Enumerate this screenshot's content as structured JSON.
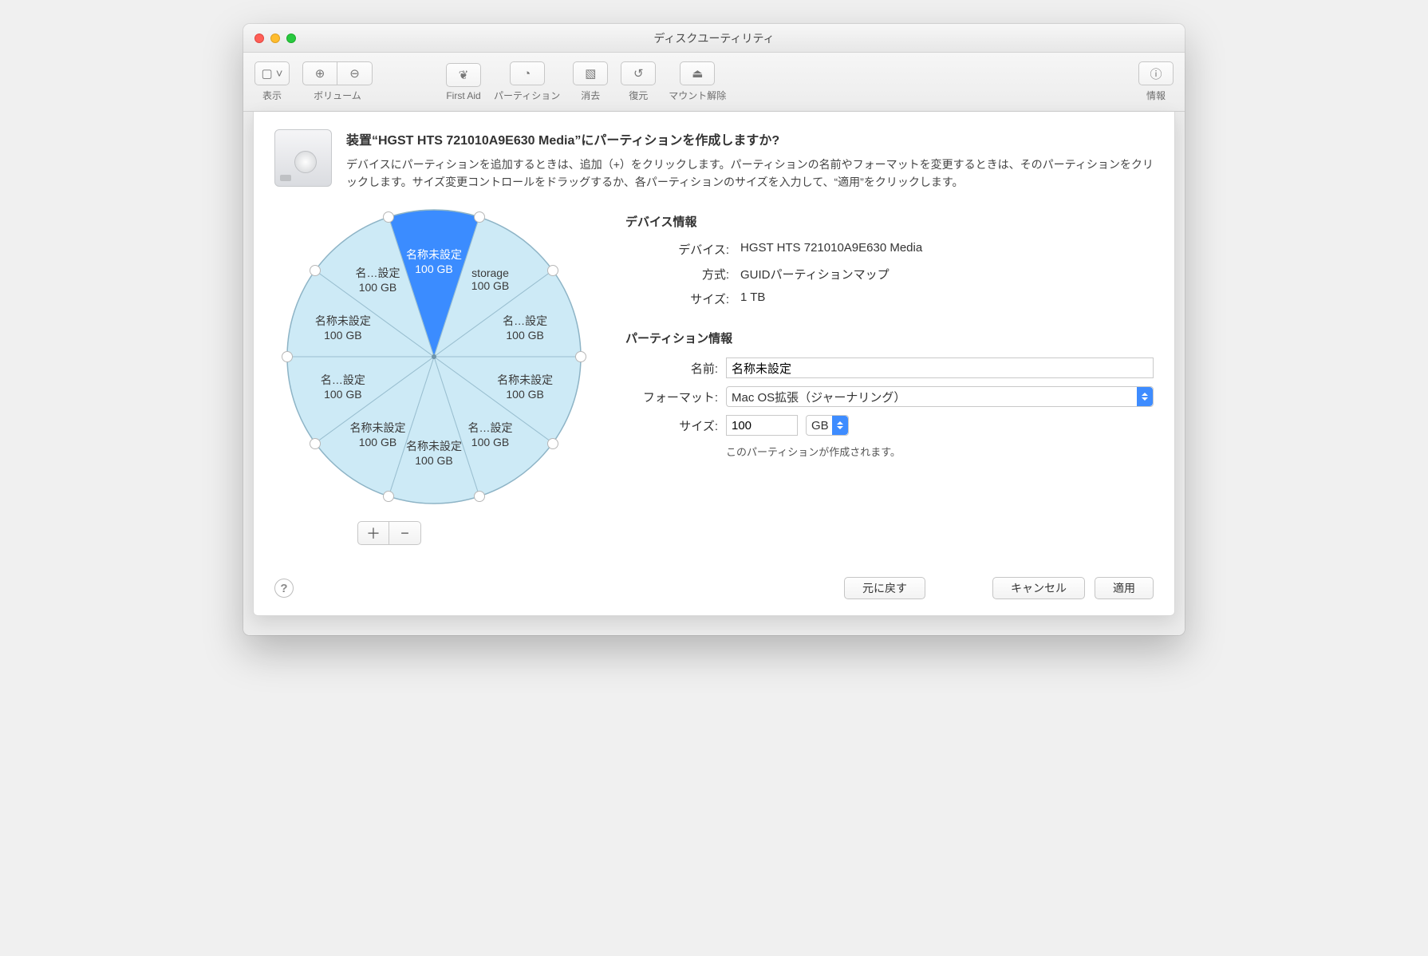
{
  "window": {
    "title": "ディスクユーティリティ"
  },
  "toolbar": {
    "view": "表示",
    "volume": "ボリューム",
    "first_aid": "First Aid",
    "partition": "パーティション",
    "erase": "消去",
    "restore": "復元",
    "unmount": "マウント解除",
    "info": "情報"
  },
  "sheet": {
    "heading": "装置“HGST HTS 721010A9E630 Media”にパーティションを作成しますか?",
    "desc": "デバイスにパーティションを追加するときは、追加（+）をクリックします。パーティションの名前やフォーマットを変更するときは、そのパーティションをクリックします。サイズ変更コントロールをドラッグするか、各パーティションのサイズを入力して、“適用”をクリックします。"
  },
  "device_info": {
    "header": "デバイス情報",
    "device_label": "デバイス:",
    "device_value": "HGST HTS 721010A9E630 Media",
    "scheme_label": "方式:",
    "scheme_value": "GUIDパーティションマップ",
    "size_label": "サイズ:",
    "size_value": "1 TB"
  },
  "partition_info": {
    "header": "パーティション情報",
    "name_label": "名前:",
    "name_value": "名称未設定",
    "format_label": "フォーマット:",
    "format_value": "Mac OS拡張（ジャーナリング）",
    "size_label": "サイズ:",
    "size_value": "100",
    "size_unit": "GB",
    "hint": "このパーティションが作成されます。"
  },
  "buttons": {
    "revert": "元に戻す",
    "cancel": "キャンセル",
    "apply": "適用",
    "add": "＋",
    "remove": "−"
  },
  "chart_data": {
    "type": "pie",
    "title": "",
    "total": "1 TB",
    "selected_index": 0,
    "series": [
      {
        "name": "名称未設定",
        "size": "100 GB",
        "selected": true
      },
      {
        "name": "storage",
        "size": "100 GB"
      },
      {
        "name": "名…設定",
        "size": "100 GB"
      },
      {
        "name": "名称未設定",
        "size": "100 GB"
      },
      {
        "name": "名…設定",
        "size": "100 GB"
      },
      {
        "name": "名称未設定",
        "size": "100 GB"
      },
      {
        "name": "名称未設定",
        "size": "100 GB"
      },
      {
        "name": "名…設定",
        "size": "100 GB"
      },
      {
        "name": "名称未設定",
        "size": "100 GB"
      },
      {
        "name": "名…設定",
        "size": "100 GB"
      }
    ]
  }
}
